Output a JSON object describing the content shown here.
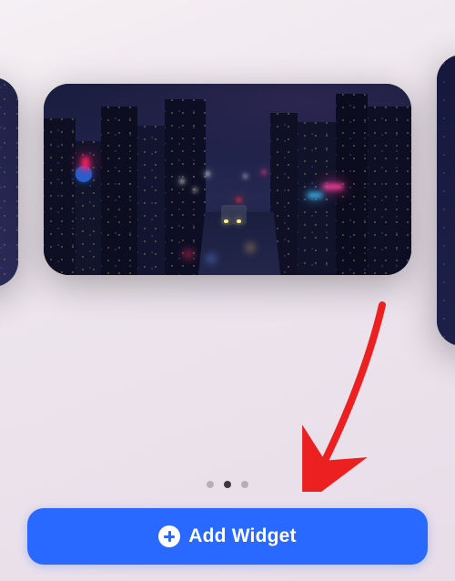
{
  "carousel": {
    "active_index": 1,
    "total_pages": 3
  },
  "button": {
    "add_widget_label": "Add Widget"
  },
  "annotation": {
    "arrow_color": "#ec2020"
  }
}
